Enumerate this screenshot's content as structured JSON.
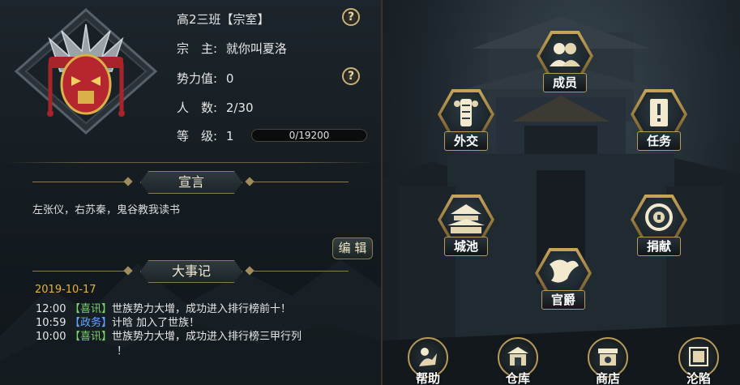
{
  "clan": {
    "name": "高2三班【宗室】",
    "leader_label": "宗　主:",
    "leader": "就你叫夏洛",
    "power_label": "势力值:",
    "power": "0",
    "members_label": "人　数:",
    "members": "2/30",
    "level_label": "等　级:",
    "level": "1",
    "exp_text": "0/19200",
    "exp_progress": 0.0
  },
  "help_symbol": "?",
  "declaration": {
    "title": "宣言",
    "text": "左张仪，右苏秦，鬼谷教我读书",
    "edit_label": "编 辑"
  },
  "events": {
    "title": "大事记",
    "date": "2019-10-17",
    "items": [
      {
        "time": "12:00",
        "tag": "【喜讯】",
        "text": "世族势力大增，成功进入排行榜前十！"
      },
      {
        "time": "10:59",
        "tag": "【政务】",
        "text": "计晗 加入了世族！"
      },
      {
        "time": "10:00",
        "tag": "【喜讯】",
        "text": "世族势力大增，成功进入排行榜三甲行列"
      }
    ],
    "wrap_text": "！"
  },
  "buttons": {
    "members": "成员",
    "diplomacy": "外交",
    "tasks": "任务",
    "city": "城池",
    "donate": "捐献",
    "rank": "官爵"
  },
  "bottom": {
    "help": "帮助",
    "warehouse": "仓库",
    "shop": "商店",
    "fallen": "沦陷"
  },
  "icons": {
    "members": "members-icon",
    "diplomacy": "diplomacy-icon",
    "tasks": "tasks-icon",
    "city": "city-icon",
    "donate": "donate-icon",
    "rank": "rank-icon",
    "help": "help-icon",
    "warehouse": "warehouse-icon",
    "shop": "shop-icon",
    "fallen": "fallen-icon"
  },
  "colors": {
    "gold": "#c9b27a",
    "date": "#e6b23c",
    "tag_good_news": "#7bd36c",
    "tag_affairs": "#64a6ff"
  }
}
